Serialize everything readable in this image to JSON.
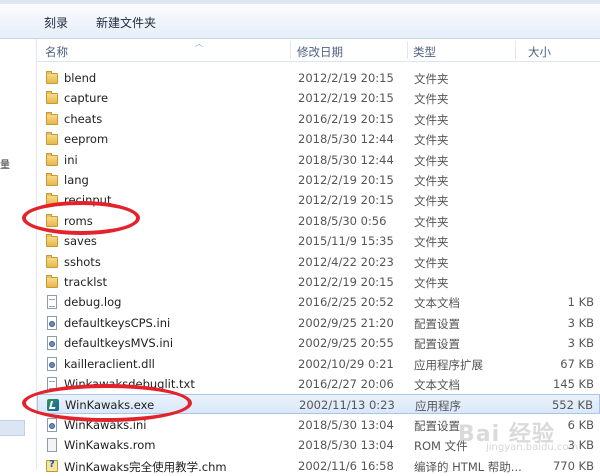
{
  "toolbar": {
    "burn_label": "刻录",
    "new_folder_label": "新建文件夹"
  },
  "columns": {
    "name": "名称",
    "date": "修改日期",
    "type": "类型",
    "size": "大小"
  },
  "nav_mark": "量",
  "files": [
    {
      "name": "blend",
      "date": "2012/2/19 20:15",
      "type": "文件夹",
      "size": "",
      "icon": "folder-icon"
    },
    {
      "name": "capture",
      "date": "2012/2/19 20:15",
      "type": "文件夹",
      "size": "",
      "icon": "folder-icon"
    },
    {
      "name": "cheats",
      "date": "2016/2/19 20:15",
      "type": "文件夹",
      "size": "",
      "icon": "folder-icon"
    },
    {
      "name": "eeprom",
      "date": "2018/5/30 12:44",
      "type": "文件夹",
      "size": "",
      "icon": "folder-icon"
    },
    {
      "name": "ini",
      "date": "2018/5/30 12:44",
      "type": "文件夹",
      "size": "",
      "icon": "folder-icon"
    },
    {
      "name": "lang",
      "date": "2012/2/19 20:15",
      "type": "文件夹",
      "size": "",
      "icon": "folder-icon"
    },
    {
      "name": "recinput",
      "date": "2012/2/19 20:15",
      "type": "文件夹",
      "size": "",
      "icon": "folder-icon"
    },
    {
      "name": "roms",
      "date": "2018/5/30 0:56",
      "type": "文件夹",
      "size": "",
      "icon": "folder-icon"
    },
    {
      "name": "saves",
      "date": "2015/11/9 15:35",
      "type": "文件夹",
      "size": "",
      "icon": "folder-icon"
    },
    {
      "name": "sshots",
      "date": "2012/4/22 20:23",
      "type": "文件夹",
      "size": "",
      "icon": "folder-icon"
    },
    {
      "name": "tracklst",
      "date": "2012/2/19 20:15",
      "type": "文件夹",
      "size": "",
      "icon": "folder-icon"
    },
    {
      "name": "debug.log",
      "date": "2016/2/25 20:52",
      "type": "文本文档",
      "size": "1 KB",
      "icon": "text-file-icon"
    },
    {
      "name": "defaultkeysCPS.ini",
      "date": "2002/9/25 21:20",
      "type": "配置设置",
      "size": "3 KB",
      "icon": "config-file-icon"
    },
    {
      "name": "defaultkeysMVS.ini",
      "date": "2002/9/25 20:55",
      "type": "配置设置",
      "size": "3 KB",
      "icon": "config-file-icon"
    },
    {
      "name": "kailleraclient.dll",
      "date": "2002/10/29 0:21",
      "type": "应用程序扩展",
      "size": "67 KB",
      "icon": "config-file-icon"
    },
    {
      "name": "Winkawaksdebuglit.txt",
      "date": "2016/2/27 20:06",
      "type": "文本文档",
      "size": "145 KB",
      "icon": "text-file-icon"
    },
    {
      "name": "WinKawaks.exe",
      "date": "2002/11/13 0:23",
      "type": "应用程序",
      "size": "552 KB",
      "icon": "exe-icon"
    },
    {
      "name": "WinKawaks.ini",
      "date": "2018/5/30 13:04",
      "type": "配置设置",
      "size": "6 KB",
      "icon": "config-file-icon"
    },
    {
      "name": "WinKawaks.rom",
      "date": "2018/5/30 13:04",
      "type": "ROM 文件",
      "size": "3 KB",
      "icon": "rom-file-icon"
    },
    {
      "name": "WinKawaks完全使用教学.chm",
      "date": "2002/11/6 16:58",
      "type": "编译的 HTML 帮助...",
      "size": "770 KB",
      "icon": "help-file-icon"
    }
  ],
  "selected_file": "WinKawaks.exe",
  "annotation_color": "#e3232c",
  "watermark": {
    "text": "Bai 经验",
    "url": "jingyan.baidu.com"
  }
}
